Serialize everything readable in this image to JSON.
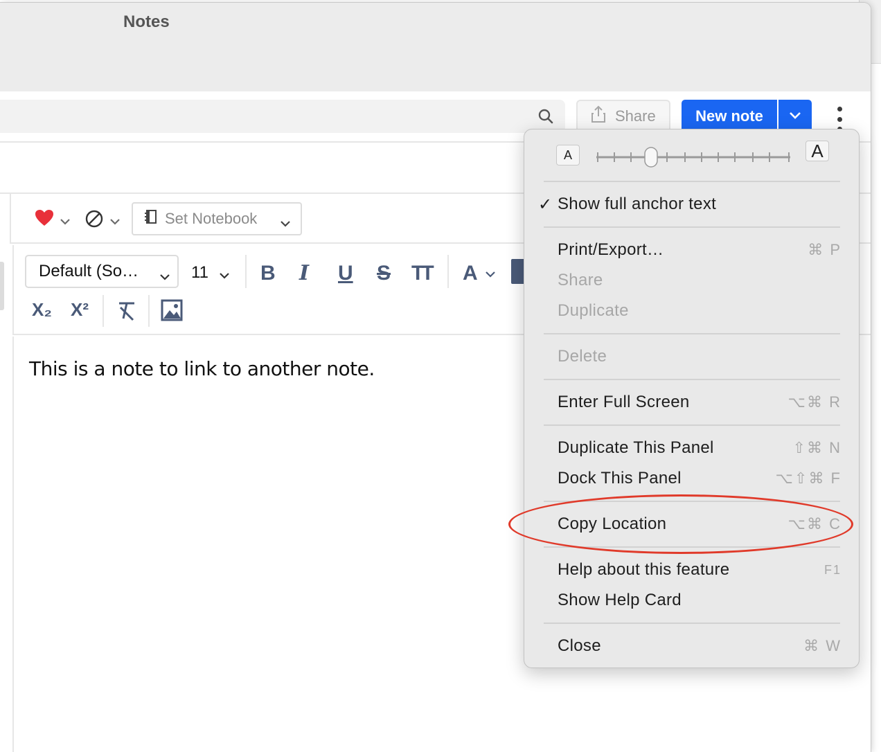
{
  "window": {
    "title": "Notes"
  },
  "toolbar": {
    "share_label": "Share",
    "new_note_label": "New note"
  },
  "tagbar": {
    "notebook_placeholder": "Set Notebook"
  },
  "format": {
    "font_family": "Default (So…",
    "font_size": "11",
    "bold": "B",
    "italic": "I",
    "underline": "U",
    "strike": "S",
    "text_size": "TT",
    "text_color": "A",
    "subscript": "X₂",
    "superscript": "X²"
  },
  "editor": {
    "content": "This is a note to link to another note."
  },
  "menu": {
    "font_small_label": "A",
    "font_large_label": "A",
    "show_full_anchor": "Show full anchor text",
    "print_export": {
      "label": "Print/Export…",
      "shortcut": "⌘ P"
    },
    "share": {
      "label": "Share"
    },
    "duplicate": {
      "label": "Duplicate"
    },
    "delete": {
      "label": "Delete"
    },
    "enter_full_screen": {
      "label": "Enter Full Screen",
      "shortcut": "⌥⌘ R"
    },
    "duplicate_panel": {
      "label": "Duplicate This Panel",
      "shortcut": "⇧⌘ N"
    },
    "dock_panel": {
      "label": "Dock This Panel",
      "shortcut": "⌥⇧⌘ F"
    },
    "copy_location": {
      "label": "Copy Location",
      "shortcut": "⌥⌘ C"
    },
    "help_feature": {
      "label": "Help about this feature",
      "shortcut": "F1"
    },
    "help_card": {
      "label": "Show Help Card"
    },
    "close": {
      "label": "Close",
      "shortcut": "⌘ W"
    }
  },
  "colors": {
    "accent": "#1a66f2",
    "favorite": "#e8303a",
    "annotation": "#e03a2a"
  }
}
